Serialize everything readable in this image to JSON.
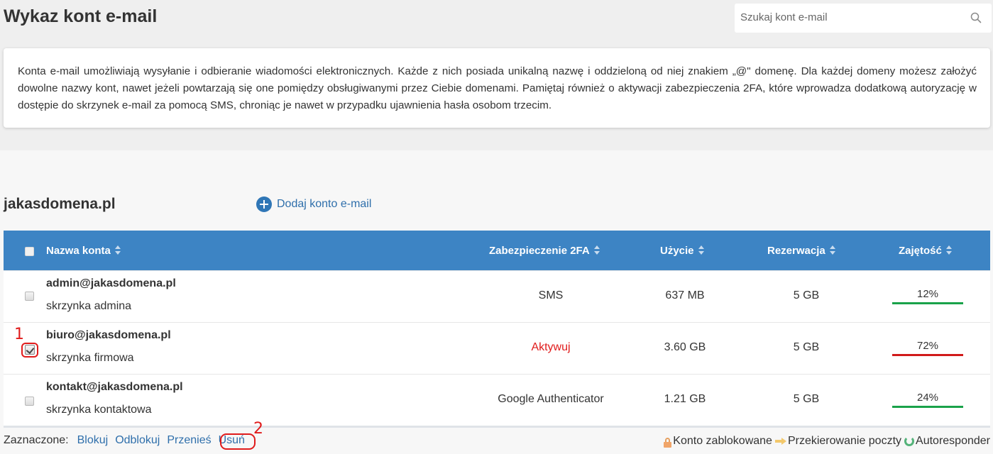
{
  "page_title": "Wykaz kont e-mail",
  "search": {
    "placeholder": "Szukaj kont e-mail"
  },
  "info_text": "Konta e-mail umożliwiają wysyłanie i odbieranie wiadomości elektronicznych. Każde z nich posiada unikalną nazwę i oddzieloną od niej znakiem „@\" domenę. Dla każdej domeny możesz założyć dowolne nazwy kont, nawet jeżeli powtarzają się one pomiędzy obsługiwanymi przez Ciebie domenami. Pamiętaj również o aktywacji zabezpieczenia 2FA, które wprowadza dodatkową autoryzację w dostępie do skrzynek e-mail za pomocą SMS, chroniąc je nawet w przypadku ujawnienia hasła osobom trzecim.",
  "domain": "jakasdomena.pl",
  "add_account_label": "Dodaj konto e-mail",
  "table": {
    "headers": {
      "name": "Nazwa konta",
      "twofa": "Zabezpieczenie 2FA",
      "usage": "Użycie",
      "reservation": "Rezerwacja",
      "occupancy": "Zajętość"
    },
    "rows": [
      {
        "account": "admin@jakasdomena.pl",
        "description": "skrzynka admina",
        "twofa": "SMS",
        "usage": "637 MB",
        "reservation": "5 GB",
        "occupancy": "12%",
        "checked": false
      },
      {
        "account": "biuro@jakasdomena.pl",
        "description": "skrzynka firmowa",
        "twofa": "Aktywuj",
        "usage": "3.60 GB",
        "reservation": "5 GB",
        "occupancy": "72%",
        "checked": true
      },
      {
        "account": "kontakt@jakasdomena.pl",
        "description": "skrzynka kontaktowa",
        "twofa": "Google Authenticator",
        "usage": "1.21 GB",
        "reservation": "5 GB",
        "occupancy": "24%",
        "checked": false
      }
    ]
  },
  "footer": {
    "selected_label": "Zaznaczone:",
    "actions": [
      "Blokuj",
      "Odblokuj",
      "Przenieś",
      "Usuń"
    ]
  },
  "legend": {
    "locked": "Konto zablokowane",
    "forwarding": "Przekierowanie poczty",
    "autoresponder": "Autoresponder"
  },
  "annotations": [
    "1",
    "2"
  ],
  "colors": {
    "header_blue": "#3d84c4",
    "link_blue": "#2f6fab",
    "alert_red": "#e01b1b",
    "bar_green": "#1aa24a",
    "bar_red": "#d11a1a"
  }
}
